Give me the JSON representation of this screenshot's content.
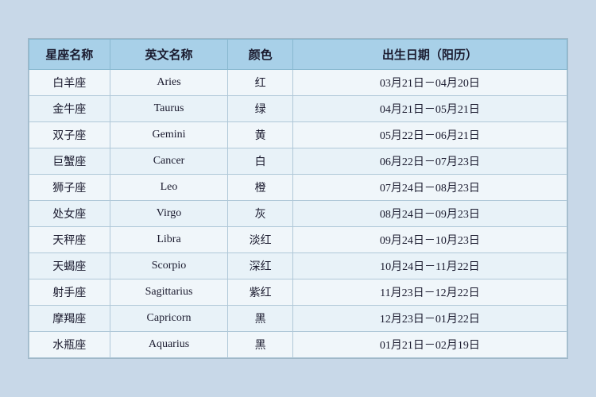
{
  "table": {
    "headers": {
      "chinese_name": "星座名称",
      "english_name": "英文名称",
      "color": "颜色",
      "birth_date": "出生日期（阳历）"
    },
    "rows": [
      {
        "chinese": "白羊座",
        "english": "Aries",
        "color": "红",
        "dates": "03月21日－04月20日"
      },
      {
        "chinese": "金牛座",
        "english": "Taurus",
        "color": "绿",
        "dates": "04月21日－05月21日"
      },
      {
        "chinese": "双子座",
        "english": "Gemini",
        "color": "黄",
        "dates": "05月22日－06月21日"
      },
      {
        "chinese": "巨蟹座",
        "english": "Cancer",
        "color": "白",
        "dates": "06月22日－07月23日"
      },
      {
        "chinese": "狮子座",
        "english": "Leo",
        "color": "橙",
        "dates": "07月24日－08月23日"
      },
      {
        "chinese": "处女座",
        "english": "Virgo",
        "color": "灰",
        "dates": "08月24日－09月23日"
      },
      {
        "chinese": "天秤座",
        "english": "Libra",
        "color": "淡红",
        "dates": "09月24日－10月23日"
      },
      {
        "chinese": "天蝎座",
        "english": "Scorpio",
        "color": "深红",
        "dates": "10月24日－11月22日"
      },
      {
        "chinese": "射手座",
        "english": "Sagittarius",
        "color": "紫红",
        "dates": "11月23日－12月22日"
      },
      {
        "chinese": "摩羯座",
        "english": "Capricorn",
        "color": "黑",
        "dates": "12月23日－01月22日"
      },
      {
        "chinese": "水瓶座",
        "english": "Aquarius",
        "color": "黑",
        "dates": "01月21日－02月19日"
      }
    ]
  }
}
